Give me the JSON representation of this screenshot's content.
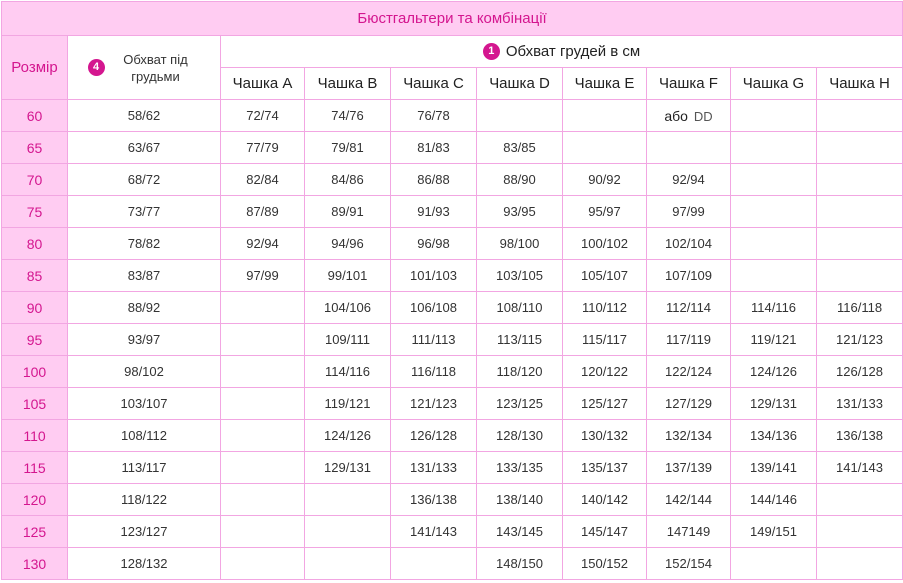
{
  "title": "Бюстгальтери та комбінації",
  "headers": {
    "size": "Розмір",
    "underbust_badge": "4",
    "underbust": "Обхват під грудьми",
    "bust_badge": "1",
    "bust": "Обхват грудей в см",
    "cups": [
      "Чашка A",
      "Чашка B",
      "Чашка C",
      "Чашка D",
      "Чашка E",
      "Чашка F",
      "Чашка G",
      "Чашка H"
    ]
  },
  "f_note": {
    "word": "або",
    "code": "DD"
  },
  "colors": {
    "accent": "#d4168f",
    "header_bg": "#ffccf2",
    "border": "#f2a6e2"
  },
  "rows": [
    {
      "size": "60",
      "underbust": "58/62",
      "cups": [
        "72/74",
        "74/76",
        "76/78",
        "",
        "",
        "",
        "",
        ""
      ]
    },
    {
      "size": "65",
      "underbust": "63/67",
      "cups": [
        "77/79",
        "79/81",
        "81/83",
        "83/85",
        "",
        "",
        "",
        ""
      ]
    },
    {
      "size": "70",
      "underbust": "68/72",
      "cups": [
        "82/84",
        "84/86",
        "86/88",
        "88/90",
        "90/92",
        "92/94",
        "",
        ""
      ]
    },
    {
      "size": "75",
      "underbust": "73/77",
      "cups": [
        "87/89",
        "89/91",
        "91/93",
        "93/95",
        "95/97",
        "97/99",
        "",
        ""
      ]
    },
    {
      "size": "80",
      "underbust": "78/82",
      "cups": [
        "92/94",
        "94/96",
        "96/98",
        "98/100",
        "100/102",
        "102/104",
        "",
        ""
      ]
    },
    {
      "size": "85",
      "underbust": "83/87",
      "cups": [
        "97/99",
        "99/101",
        "101/103",
        "103/105",
        "105/107",
        "107/109",
        "",
        ""
      ]
    },
    {
      "size": "90",
      "underbust": "88/92",
      "cups": [
        "",
        "104/106",
        "106/108",
        "108/110",
        "110/112",
        "112/114",
        "114/116",
        "116/118"
      ]
    },
    {
      "size": "95",
      "underbust": "93/97",
      "cups": [
        "",
        "109/111",
        "111/113",
        "113/115",
        "115/117",
        "117/119",
        "119/121",
        "121/123"
      ]
    },
    {
      "size": "100",
      "underbust": "98/102",
      "cups": [
        "",
        "114/116",
        "116/118",
        "118/120",
        "120/122",
        "122/124",
        "124/126",
        "126/128"
      ]
    },
    {
      "size": "105",
      "underbust": "103/107",
      "cups": [
        "",
        "119/121",
        "121/123",
        "123/125",
        "125/127",
        "127/129",
        "129/131",
        "131/133"
      ]
    },
    {
      "size": "110",
      "underbust": "108/112",
      "cups": [
        "",
        "124/126",
        "126/128",
        "128/130",
        "130/132",
        "132/134",
        "134/136",
        "136/138"
      ]
    },
    {
      "size": "115",
      "underbust": "113/117",
      "cups": [
        "",
        "129/131",
        "131/133",
        "133/135",
        "135/137",
        "137/139",
        "139/141",
        "141/143"
      ]
    },
    {
      "size": "120",
      "underbust": "118/122",
      "cups": [
        "",
        "",
        "136/138",
        "138/140",
        "140/142",
        "142/144",
        "144/146",
        ""
      ]
    },
    {
      "size": "125",
      "underbust": "123/127",
      "cups": [
        "",
        "",
        "141/143",
        "143/145",
        "145/147",
        "147149",
        "149/151",
        ""
      ]
    },
    {
      "size": "130",
      "underbust": "128/132",
      "cups": [
        "",
        "",
        "",
        "148/150",
        "150/152",
        "152/154",
        "",
        ""
      ]
    }
  ]
}
